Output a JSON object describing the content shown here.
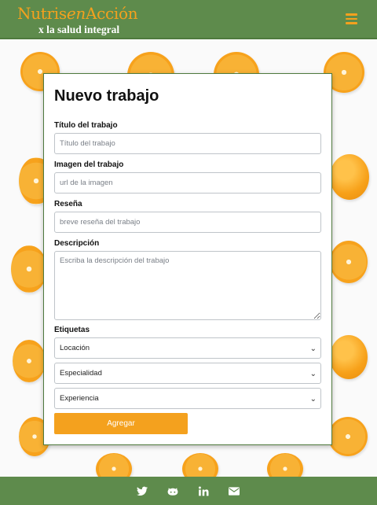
{
  "header": {
    "brand_prefix": "Nutris",
    "brand_en": "en",
    "brand_suffix": "Acción",
    "tagline": "x la salud integral",
    "menu_icon": "hamburger-icon"
  },
  "form": {
    "title": "Nuevo trabajo",
    "fields": {
      "titulo": {
        "label": "Título del trabajo",
        "placeholder": "Título del trabajo",
        "value": ""
      },
      "imagen": {
        "label": "Imagen del trabajo",
        "placeholder": "url de la imagen",
        "value": ""
      },
      "resena": {
        "label": "Reseña",
        "placeholder": "breve reseña del trabajo",
        "value": ""
      },
      "descripcion": {
        "label": "Descripción",
        "placeholder": "Escriba la descripción del trabajo",
        "value": ""
      }
    },
    "etiquetas_label": "Etiquetas",
    "selects": {
      "locacion": "Locación",
      "especialidad": "Especialidad",
      "experiencia": "Experiencia"
    },
    "submit_label": "Agregar"
  },
  "footer": {
    "icons": [
      "twitter-icon",
      "github-icon",
      "linkedin-icon",
      "email-icon"
    ]
  },
  "colors": {
    "header_green": "#5e8b4c",
    "accent_orange": "#f4a11e"
  }
}
